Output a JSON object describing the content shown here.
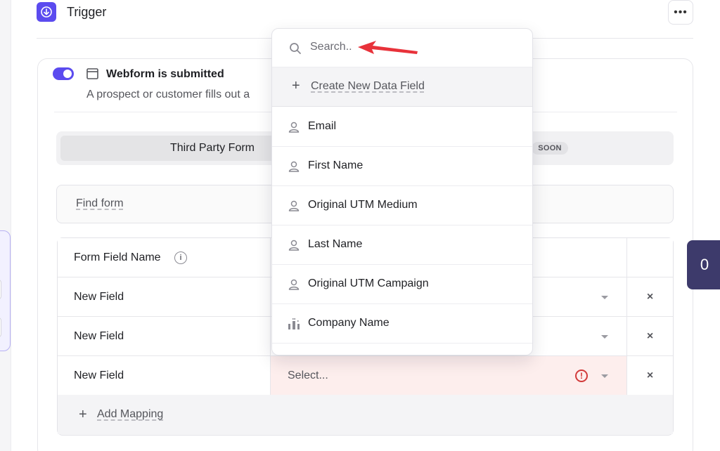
{
  "header": {
    "title": "Trigger",
    "more_label": "•••"
  },
  "trigger": {
    "title": "Webform is submitted",
    "description": "A prospect or customer fills out a",
    "toggle_on": true
  },
  "source_tabs": {
    "active": "Third Party Form",
    "soon_badge": "SOON"
  },
  "find_form": {
    "label": "Find form"
  },
  "mapping_table": {
    "header": "Form Field Name",
    "rows": [
      {
        "name": "New Field",
        "value": ""
      },
      {
        "name": "New Field",
        "value": ""
      },
      {
        "name": "New Field",
        "value": "Select...",
        "error": true
      }
    ],
    "delete_symbol": "×",
    "add_label": "Add Mapping",
    "add_symbol": "+"
  },
  "counter": {
    "value": "0"
  },
  "dropdown": {
    "search_placeholder": "Search..",
    "create_label": "Create New Data Field",
    "create_symbol": "+",
    "items": [
      {
        "label": "Email",
        "icon": "person-icon"
      },
      {
        "label": "First Name",
        "icon": "person-icon"
      },
      {
        "label": "Original UTM Medium",
        "icon": "person-icon"
      },
      {
        "label": "Last Name",
        "icon": "person-icon"
      },
      {
        "label": "Original UTM Campaign",
        "icon": "person-icon"
      },
      {
        "label": "Company Name",
        "icon": "building-icon"
      }
    ]
  },
  "colors": {
    "accent": "#5b4bef",
    "error": "#d23a3a",
    "counter_bg": "#3d3a6b",
    "annotation": "#e8323a"
  }
}
